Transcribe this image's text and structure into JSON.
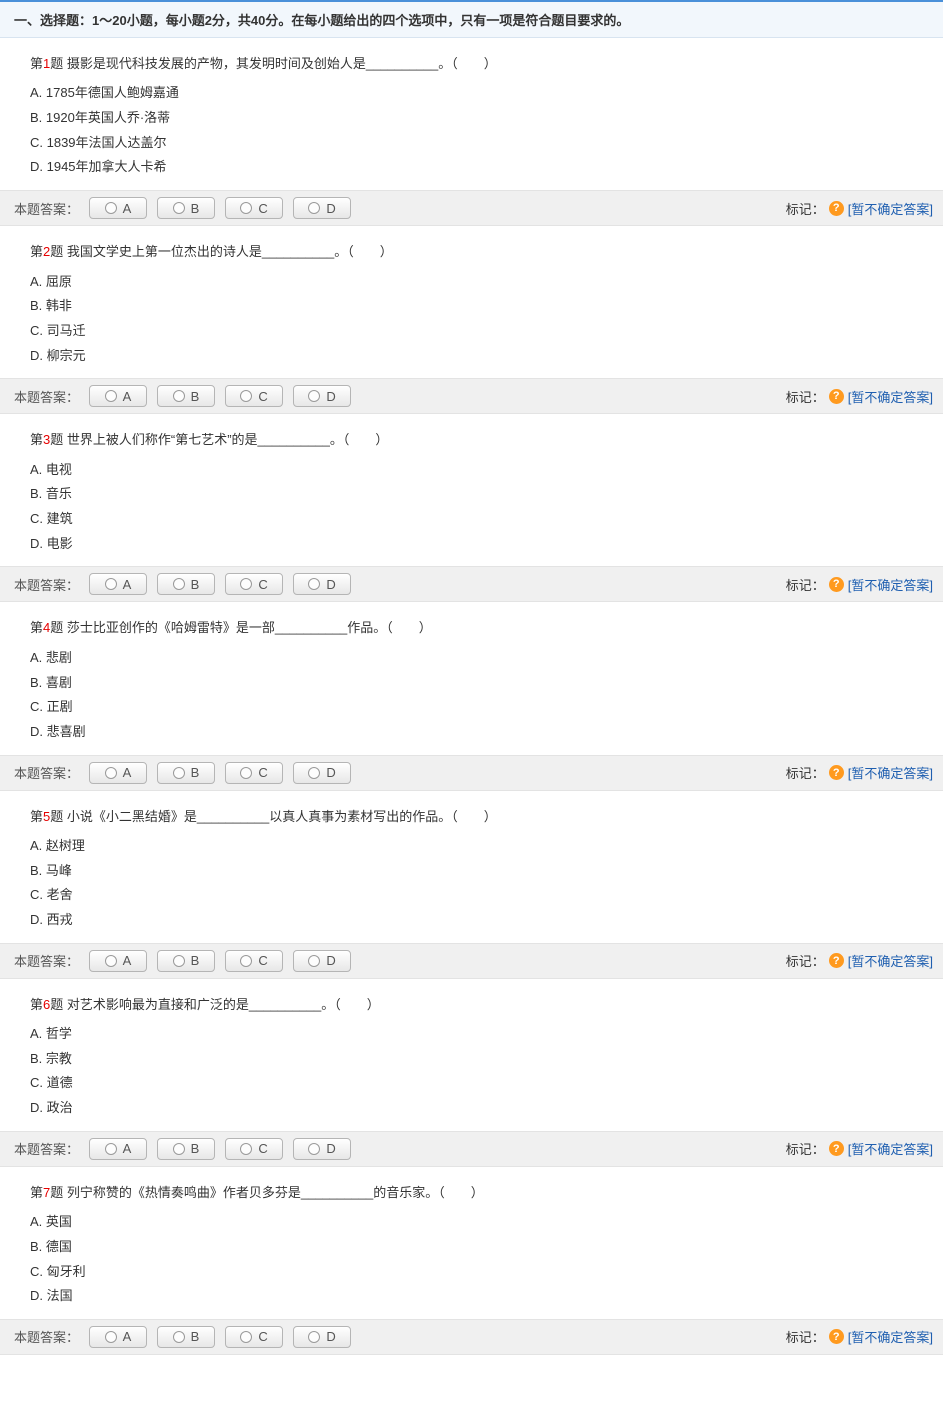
{
  "section_header": "一、选择题：1～20小题，每小题2分，共40分。在每小题给出的四个选项中，只有一项是符合题目要求的。",
  "answer_label": "本题答案：",
  "mark_label": "标记：",
  "uncertain_text": "[暂不确定答案]",
  "choice_letters": [
    "A",
    "B",
    "C",
    "D"
  ],
  "questions": [
    {
      "num_prefix": "第",
      "num": "1",
      "num_suffix": "题",
      "text": "摄影是现代科技发展的产物，其发明时间及创始人是__________。（　　）",
      "options": [
        "A. 1785年德国人鲍姆嘉通",
        "B. 1920年英国人乔·洛蒂",
        "C. 1839年法国人达盖尔",
        "D. 1945年加拿大人卡希"
      ]
    },
    {
      "num_prefix": "第",
      "num": "2",
      "num_suffix": "题",
      "text": "我国文学史上第一位杰出的诗人是__________。（　　）",
      "options": [
        "A. 屈原",
        "B. 韩非",
        "C. 司马迁",
        "D. 柳宗元"
      ]
    },
    {
      "num_prefix": "第",
      "num": "3",
      "num_suffix": "题",
      "text": "世界上被人们称作“第七艺术”的是__________。（　　）",
      "options": [
        "A. 电视",
        "B. 音乐",
        "C. 建筑",
        "D. 电影"
      ]
    },
    {
      "num_prefix": "第",
      "num": "4",
      "num_suffix": "题",
      "text": "莎士比亚创作的《哈姆雷特》是一部__________作品。（　　）",
      "options": [
        "A. 悲剧",
        "B. 喜剧",
        "C. 正剧",
        "D. 悲喜剧"
      ]
    },
    {
      "num_prefix": "第",
      "num": "5",
      "num_suffix": "题",
      "text": "小说《小二黑结婚》是__________以真人真事为素材写出的作品。（　　）",
      "options": [
        "A. 赵树理",
        "B. 马峰",
        "C. 老舍",
        "D. 西戎"
      ]
    },
    {
      "num_prefix": "第",
      "num": "6",
      "num_suffix": "题",
      "text": "对艺术影响最为直接和广泛的是__________。（　　）",
      "options": [
        "A. 哲学",
        "B. 宗教",
        "C. 道德",
        "D. 政治"
      ]
    },
    {
      "num_prefix": "第",
      "num": "7",
      "num_suffix": "题",
      "text": "列宁称赞的《热情奏鸣曲》作者贝多芬是__________的音乐家。（　　）",
      "options": [
        "A. 英国",
        "B. 德国",
        "C. 匈牙利",
        "D. 法国"
      ]
    }
  ]
}
